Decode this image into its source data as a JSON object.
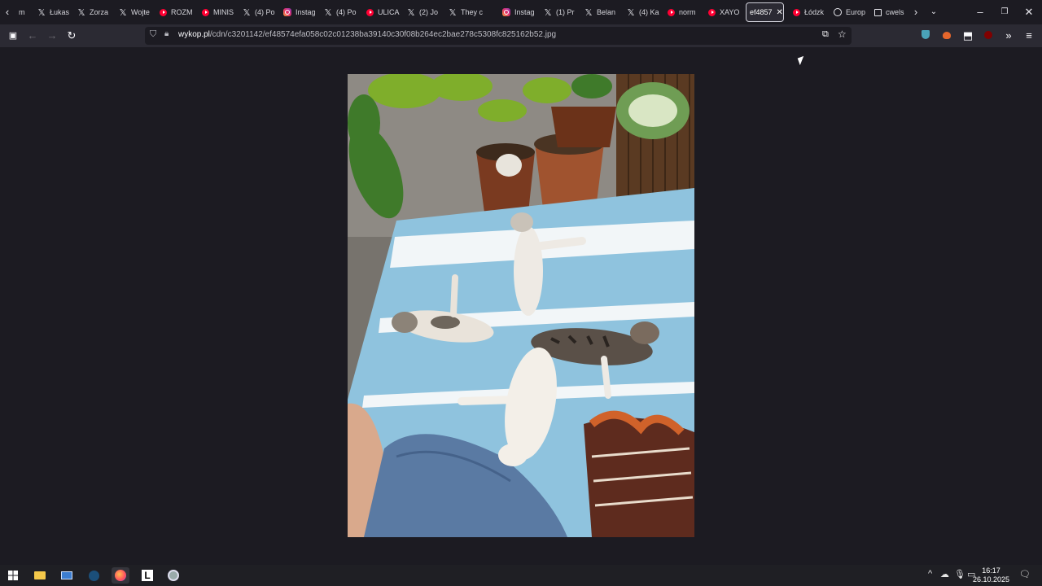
{
  "browser": {
    "tabs": [
      {
        "label": "m",
        "icon": "generic-icon"
      },
      {
        "label": "Łukas",
        "icon": "x-icon"
      },
      {
        "label": "Zorza",
        "icon": "x-icon"
      },
      {
        "label": "Wojte",
        "icon": "x-icon"
      },
      {
        "label": "ROZM",
        "icon": "youtube-icon"
      },
      {
        "label": "MINIS",
        "icon": "youtube-icon"
      },
      {
        "label": "(4) Po",
        "icon": "x-icon"
      },
      {
        "label": "Instag",
        "icon": "instagram-icon"
      },
      {
        "label": "(4) Po",
        "icon": "x-icon"
      },
      {
        "label": "ULICA",
        "icon": "youtube-icon"
      },
      {
        "label": "(2) Jo",
        "icon": "x-icon"
      },
      {
        "label": "They c",
        "icon": "x-icon"
      },
      {
        "label": "Instag",
        "icon": "instagram-icon"
      },
      {
        "label": "(1) Pr",
        "icon": "x-icon"
      },
      {
        "label": "Belan",
        "icon": "x-icon"
      },
      {
        "label": "(4) Ka",
        "icon": "x-icon"
      },
      {
        "label": "norm",
        "icon": "youtube-icon"
      },
      {
        "label": "XAYO",
        "icon": "youtube-icon"
      },
      {
        "label": "ef4857",
        "icon": "none",
        "active": true
      },
      {
        "label": "Łódzk",
        "icon": "youtube-icon"
      },
      {
        "label": "Europ",
        "icon": "globe-icon"
      },
      {
        "label": "cwels",
        "icon": "sheet-icon"
      }
    ],
    "url_host": "wykop.pl",
    "url_path": "/cdn/c3201142/ef48574efa058c02c01238ba39140c30f08b264ec2bae278c5308fc825162b52.jpg",
    "colors": {
      "chrome": "#1c1b22",
      "toolbar": "#2b2a33",
      "accent": "#ff0033"
    }
  },
  "taskbar": {
    "time": "16:17",
    "date": "26.10.2025"
  }
}
